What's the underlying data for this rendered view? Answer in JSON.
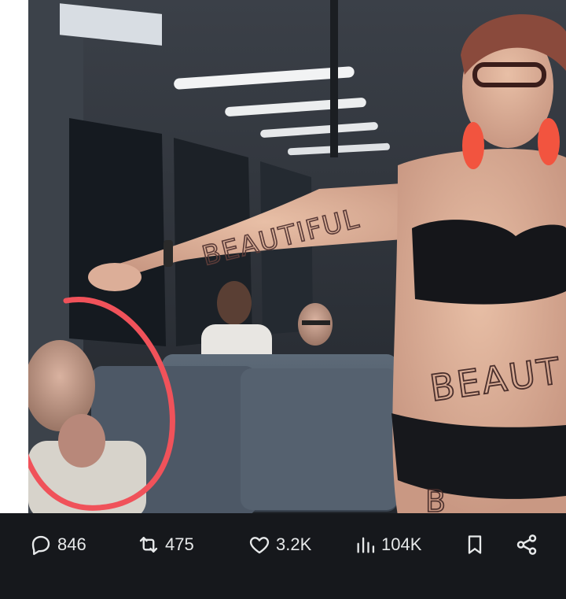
{
  "post": {
    "image_alt": "",
    "body_text": {
      "arm": "BEAUTIFUL",
      "stomach": "BEAUT",
      "leg": "B"
    }
  },
  "actions": {
    "replies": "846",
    "reposts": "475",
    "likes": "3.2K",
    "views": "104K"
  },
  "icons": {
    "reply": "reply-icon",
    "repost": "repost-icon",
    "like": "heart-icon",
    "views": "views-icon",
    "bookmark": "bookmark-icon",
    "share": "share-icon"
  },
  "colors": {
    "annotation_circle": "#f0525a",
    "bar_background": "#16181c",
    "icon_text": "#e7e9ea"
  }
}
